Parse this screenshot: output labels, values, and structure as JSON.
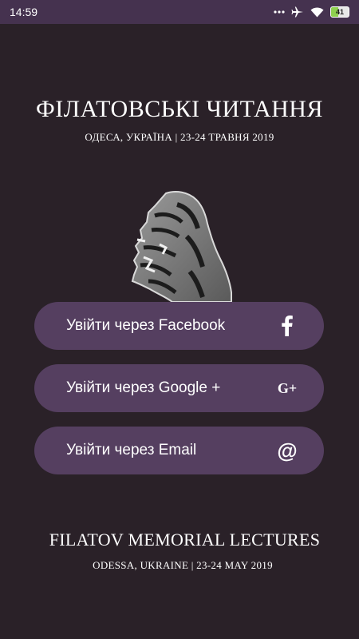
{
  "status_bar": {
    "time": "14:59",
    "battery": "41",
    "icons": [
      "dots-icon",
      "airplane-icon",
      "wifi-icon",
      "battery-icon"
    ]
  },
  "header": {
    "title": "ФІЛАТОВСЬКІ ЧИТАННЯ",
    "subtitle": "ОДЕСА, УКРАЇНА |  23-24 ТРАВНЯ 2019"
  },
  "login": {
    "facebook_label": "Увійти через Facebook",
    "google_label": "Увійти через Google +",
    "email_label": "Увійти через Email",
    "google_icon_text": "G+",
    "email_icon_text": "@"
  },
  "footer": {
    "title": "FILATOV MEMORIAL LECTURES",
    "subtitle": "ODESSA, UKRAINE |  23-24 MAY 2019"
  },
  "colors": {
    "background": "#2a2128",
    "statusbar": "#45324f",
    "button": "#553f60",
    "text": "#ffffff"
  }
}
